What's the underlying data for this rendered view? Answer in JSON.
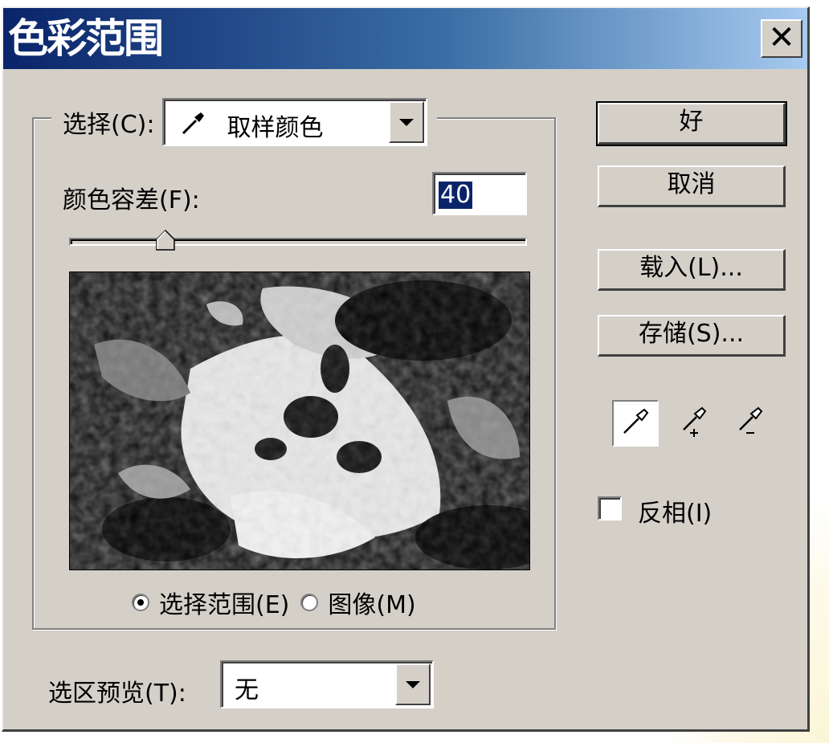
{
  "window": {
    "title": "色彩范围"
  },
  "select": {
    "label": "选择(C):",
    "value": "取样颜色",
    "icon": "eyedropper-icon"
  },
  "fuzziness": {
    "label": "颜色容差(F):",
    "value": "40",
    "slider_fraction": 0.21
  },
  "preview_mode": {
    "selection_label": "选择范围(E)",
    "image_label": "图像(M)",
    "selected": "selection"
  },
  "selection_preview": {
    "label": "选区预览(T):",
    "value": "无"
  },
  "buttons": {
    "ok": "好",
    "cancel": "取消",
    "load": "载入(L)...",
    "save": "存储(S)..."
  },
  "tools": [
    "eyedropper-icon",
    "eyedropper-plus-icon",
    "eyedropper-minus-icon"
  ],
  "invert": {
    "label": "反相(I)",
    "checked": false
  },
  "colors": {
    "face": "#d4d0c8",
    "title_start": "#0a246a",
    "title_end": "#a6caf0",
    "highlight": "#0a246a"
  }
}
